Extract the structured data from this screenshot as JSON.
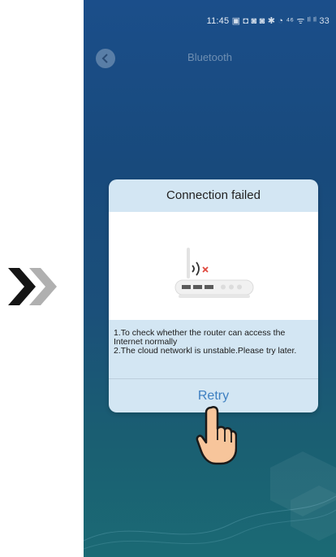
{
  "status_bar": {
    "time": "11:45",
    "icons_text": "▣ ◘  ◙ ◙ ✱ ◔ ⁴⁶ ᯤ ᴵˡ ᴵˡ 33"
  },
  "header": {
    "title": "Bluetooth"
  },
  "dialog": {
    "title": "Connection failed",
    "message_line1": "1.To check whether the router can access the Internet normally",
    "message_line2": "2.The cloud networkl is unstable.Please try later.",
    "retry_label": "Retry"
  },
  "colors": {
    "accent": "#3d7fc1",
    "dialog_bg": "#d3e6f3",
    "phone_bg": "#1b4e8a",
    "error_x": "#e0483e"
  },
  "icons": [
    "double-chevron-icon",
    "back-arrow-icon",
    "router-icon",
    "wifi-signal-icon",
    "error-x-icon",
    "pointing-hand-icon"
  ]
}
